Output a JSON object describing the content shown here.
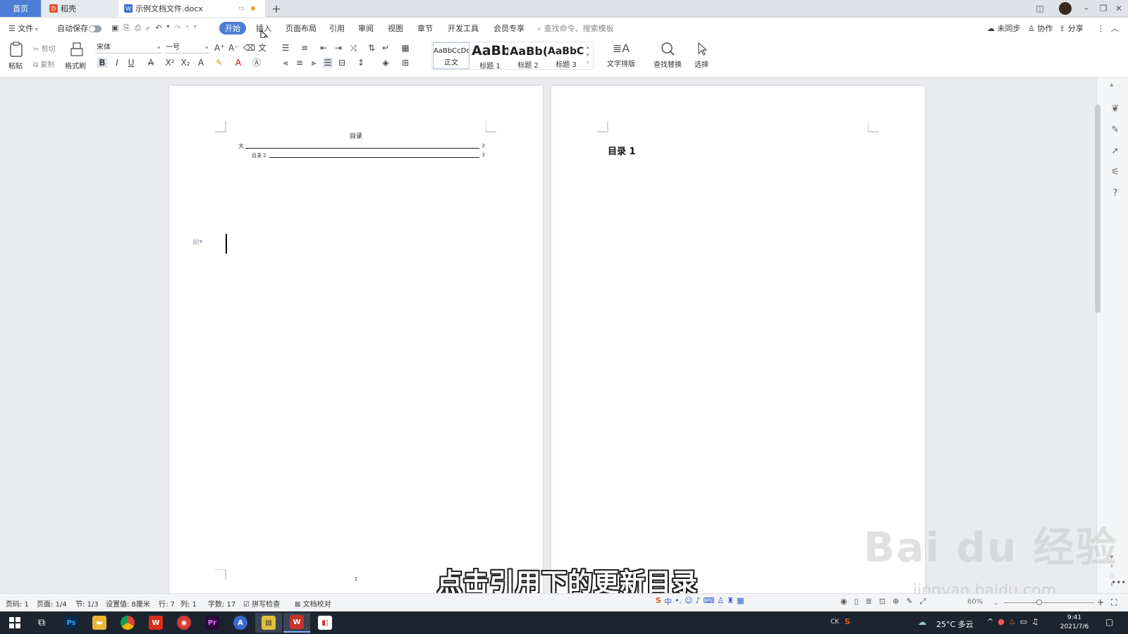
{
  "tabs": {
    "home": "首页",
    "daoke": "稻壳",
    "doc": "示例文档文件.docx",
    "new_tab": "+"
  },
  "menubar": {
    "file": "文件",
    "autosave": "自动保存",
    "items": [
      "开始",
      "插入",
      "页面布局",
      "引用",
      "审阅",
      "视图",
      "章节",
      "开发工具",
      "会员专享"
    ],
    "search_placeholder": "查找命令、搜索模板",
    "sync": "未同步",
    "collab": "协作",
    "share": "分享"
  },
  "ribbon": {
    "paste": "粘贴",
    "cut": "剪切",
    "copy": "复制",
    "format_painter": "格式刷",
    "font_name": "宋体",
    "font_size": "一号",
    "styles": [
      {
        "sample": "AaBbCcDd",
        "label": "正文"
      },
      {
        "sample": "AaBb",
        "label": "标题 1"
      },
      {
        "sample": "AaBb(",
        "label": "标题 2"
      },
      {
        "sample": "AaBbC(",
        "label": "标题 3"
      }
    ],
    "text_layout": "文字排版",
    "find_replace": "查找替换",
    "select": "选择"
  },
  "document": {
    "toc_title": "目录",
    "toc_entries": [
      {
        "text": "大",
        "page": "2"
      },
      {
        "text": "目录 2",
        "page": "3"
      }
    ],
    "page_number": "1",
    "page2_heading": "目录 1"
  },
  "status": {
    "page_code": "页码: 1",
    "page": "页面: 1/4",
    "section": "节: 1/3",
    "setting": "设置值: 8厘米",
    "row": "行: 7",
    "col": "列: 1",
    "words": "字数: 17",
    "spell": "拼写检查",
    "proof": "文档校对",
    "zoom": "60%"
  },
  "subtitle": "点击引用下的更新目录",
  "watermark": {
    "main": "Bai du 经验",
    "url": "jingyan.baidu.com"
  },
  "taskbar": {
    "weather": "25°C 多云",
    "time": "9:41",
    "date": "2021/7/6",
    "ime": "CK"
  },
  "colors": {
    "accent": "#4b7ed4",
    "taskbar": "#1c2430"
  }
}
